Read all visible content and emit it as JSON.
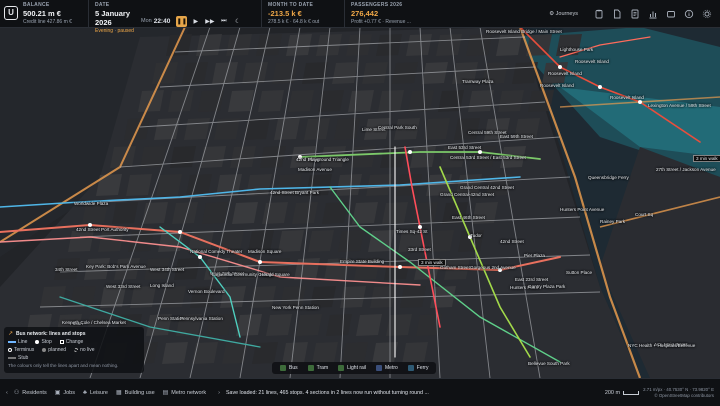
{
  "topbar": {
    "balance_label": "BALANCE",
    "balance_value": "500.21 m €",
    "credit_line": "Credit line 427.86 m €",
    "date_label": "DATE",
    "date_value": "5 January 2026",
    "time_of_day": "Evening",
    "time_status": "paused",
    "weekday": "Mon",
    "clock": "22:40",
    "month_label": "MONTH TO DATE",
    "month_value": "-213.5 k €",
    "month_sub1": "278.5 k €",
    "month_sub2": "64.8 k € out",
    "passengers_label": "PASSENGERS 2026",
    "passengers_value": "276,442",
    "profit": "Profit +0.77 €",
    "revenue": "Revenue ...",
    "journeys_label": "Journeys"
  },
  "legend": {
    "title": "Bus network: lines and stops",
    "line": "Line",
    "stop": "Stop",
    "change": "Change",
    "terminus": "Terminus",
    "planned": "planned",
    "no_live": "no live",
    "stub": "Stub",
    "note": "The colours only tell the lines apart and mean nothing."
  },
  "modes": [
    "Bus",
    "Tram",
    "Light rail",
    "Metro",
    "Ferry"
  ],
  "bottombar": {
    "items": [
      "Residents",
      "Jobs",
      "Leisure",
      "Building use",
      "Metro network"
    ],
    "status_message": "Save loaded: 21 lines, 465 stops. 4 sections in 2 lines now run without turning round ...",
    "scale": "200 m",
    "zoom": "2.71 m/px",
    "coords": "40.7530° N · 73.9820° E",
    "attribution": "© OpenStreetMap contributors"
  },
  "map_labels": [
    "Roosevelt Island Bridge / Main Street",
    "Lighthouse Park",
    "Roosevelt Island",
    "Roosevelt Island",
    "Roosevelt Island",
    "Tramway Plaza",
    "Roosevelt Island",
    "Central 59th Street",
    "East 59th Street",
    "Lexington Avenue / 59th Street",
    "Lime Street",
    "Central Park South",
    "East 53rd Street",
    "Central 53rd Street / East 53rd Street",
    "42nd Street",
    "Madison Avenue",
    "Playground Triangle",
    "42nd Street Bryant Park",
    "Grand Central 42nd Street",
    "Grand Central-42nd Street",
    "East 46th Street",
    "Times Sq-42 St",
    "Tudor",
    "42nd Street",
    "Pier Plaza",
    "Rainey Park",
    "Queensbridge Ferry",
    "Hunters Point Avenue",
    "3 min walk",
    "27th Street / Jackson Avenue",
    "Court Sq",
    "National Comedy Theater",
    "West 39th Street",
    "42nd Street Port Authority",
    "Worldwide Plaza",
    "34th Street",
    "Madison Square",
    "Empire State Building",
    "33rd Street",
    "3 min walk",
    "Gotham Street",
    "Gorgeous 2nd Avenue",
    "East 23rd Street",
    "Sutton Place",
    "Hunters Point",
    "Gantry Plaza Park",
    "Lagaurdia Community College",
    "Herald Square",
    "Key Park: Bob's Park Avenue",
    "West 34th Street",
    "Long Island",
    "Vernon Boulevard",
    "Penn Station",
    "New York Penn Station",
    "Pennsylvania Station",
    "West 33rd Street",
    "Fulton",
    "Kenneth Cole / Chelsea Market",
    "ACL Main Street",
    "NYC Health + Hospitals/Bellevue",
    "Bellevue South Park"
  ]
}
